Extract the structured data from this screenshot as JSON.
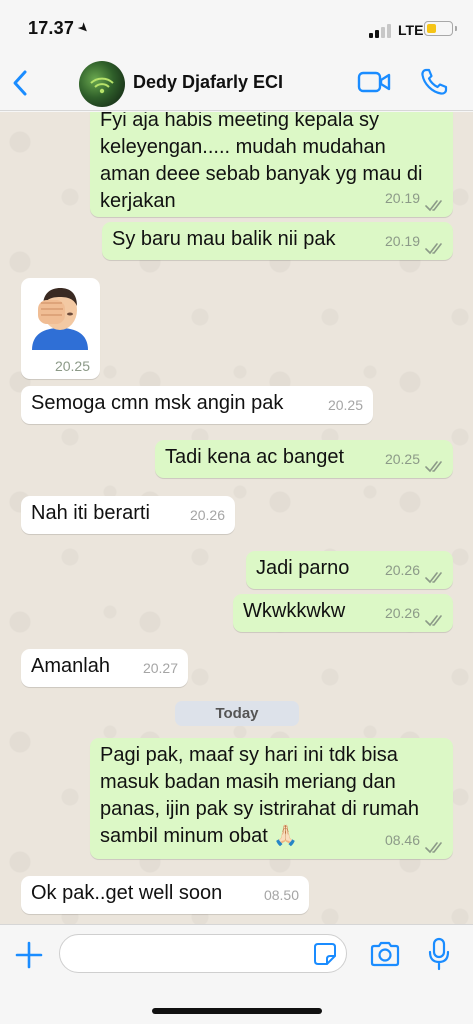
{
  "status_bar": {
    "time": "17.37",
    "network": "LTE",
    "battery_level": 0.4
  },
  "header": {
    "contact_name": "Dedy Djafarly ECI"
  },
  "day_divider": "Today",
  "messages": [
    {
      "direction": "out",
      "lines": [
        "Fyi aja habis meeting kepala sy",
        "keleyengan..... mudah mudahan",
        "aman deee sebab banyak yg mau di",
        "kerjakan"
      ],
      "time": "20.19"
    },
    {
      "direction": "out",
      "lines": [
        "Sy baru mau balik nii pak"
      ],
      "time": "20.19"
    },
    {
      "direction": "in",
      "type": "sticker",
      "sticker": "face-palm-emoji",
      "time": "20.25"
    },
    {
      "direction": "in",
      "lines": [
        "Semoga cmn msk angin pak"
      ],
      "time": "20.25"
    },
    {
      "direction": "out",
      "lines": [
        "Tadi kena ac banget"
      ],
      "time": "20.25"
    },
    {
      "direction": "in",
      "lines": [
        "Nah iti berarti"
      ],
      "time": "20.26"
    },
    {
      "direction": "out",
      "lines": [
        "Jadi parno"
      ],
      "time": "20.26"
    },
    {
      "direction": "out",
      "lines": [
        "Wkwkkwkw"
      ],
      "time": "20.26"
    },
    {
      "direction": "in",
      "lines": [
        "Amanlah"
      ],
      "time": "20.27"
    },
    {
      "direction": "out",
      "lines": [
        "Pagi pak, maaf sy hari ini tdk bisa",
        "masuk badan masih meriang dan",
        "panas, ijin pak sy istrirahat di rumah",
        "sambil minum obat 🙏🏻"
      ],
      "time": "08.46"
    },
    {
      "direction": "in",
      "lines": [
        "Ok pak..get well soon"
      ],
      "time": "08.50"
    }
  ],
  "composer": {
    "value": "",
    "placeholder": ""
  },
  "colors": {
    "accent": "#1a8cff",
    "outgoing_bubble": "#dcf8c6",
    "incoming_bubble": "#ffffff",
    "chat_background": "#ebe5dc"
  }
}
